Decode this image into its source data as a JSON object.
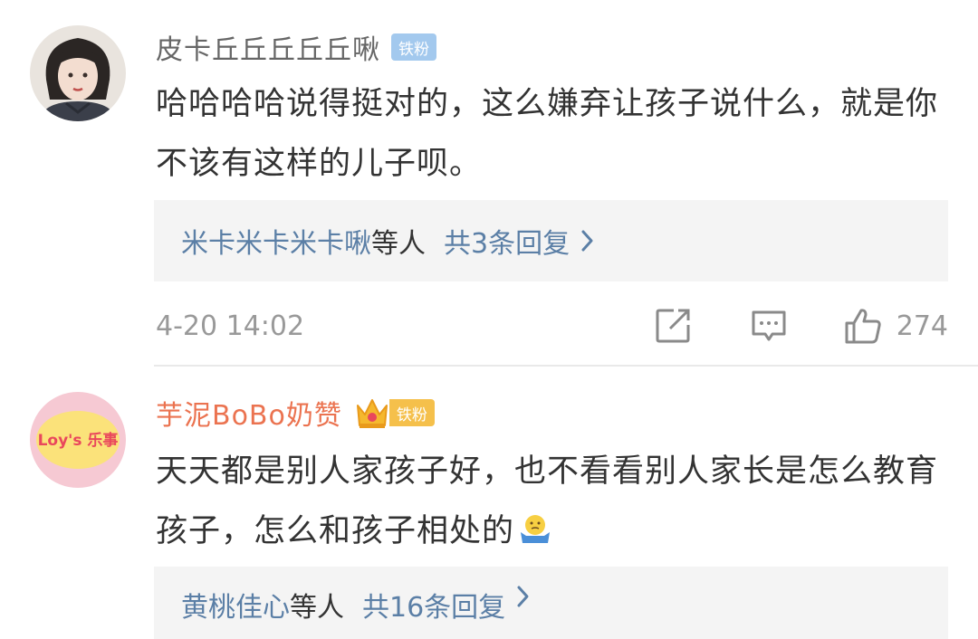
{
  "comments": [
    {
      "username": "皮卡丘丘丘丘丘啾",
      "badge": "铁粉",
      "text": "哈哈哈哈说得挺对的，这么嫌弃让孩子说什么，就是你不该有这样的儿子呗。",
      "replies": {
        "names": "米卡米卡米卡啾",
        "etc": "等人",
        "total": "共3条回复"
      },
      "timestamp": "4-20 14:02",
      "likes": "274"
    },
    {
      "username": "芋泥BoBo奶赞",
      "badge": "铁粉",
      "avatar_text": "Loy's 乐事",
      "text": "天天都是别人家孩子好，也不看看别人家长是怎么教育孩子，怎么和孩子相处的",
      "emoji": "shrug-emoji",
      "replies": {
        "names": "黄桃佳心",
        "etc": "等人",
        "total": "共16条回复"
      }
    }
  ],
  "colors": {
    "username_vip": "#eb7350",
    "link": "#5b7fa6",
    "badge_blue": "#a3c9ee",
    "badge_gold": "#f5c04b"
  }
}
